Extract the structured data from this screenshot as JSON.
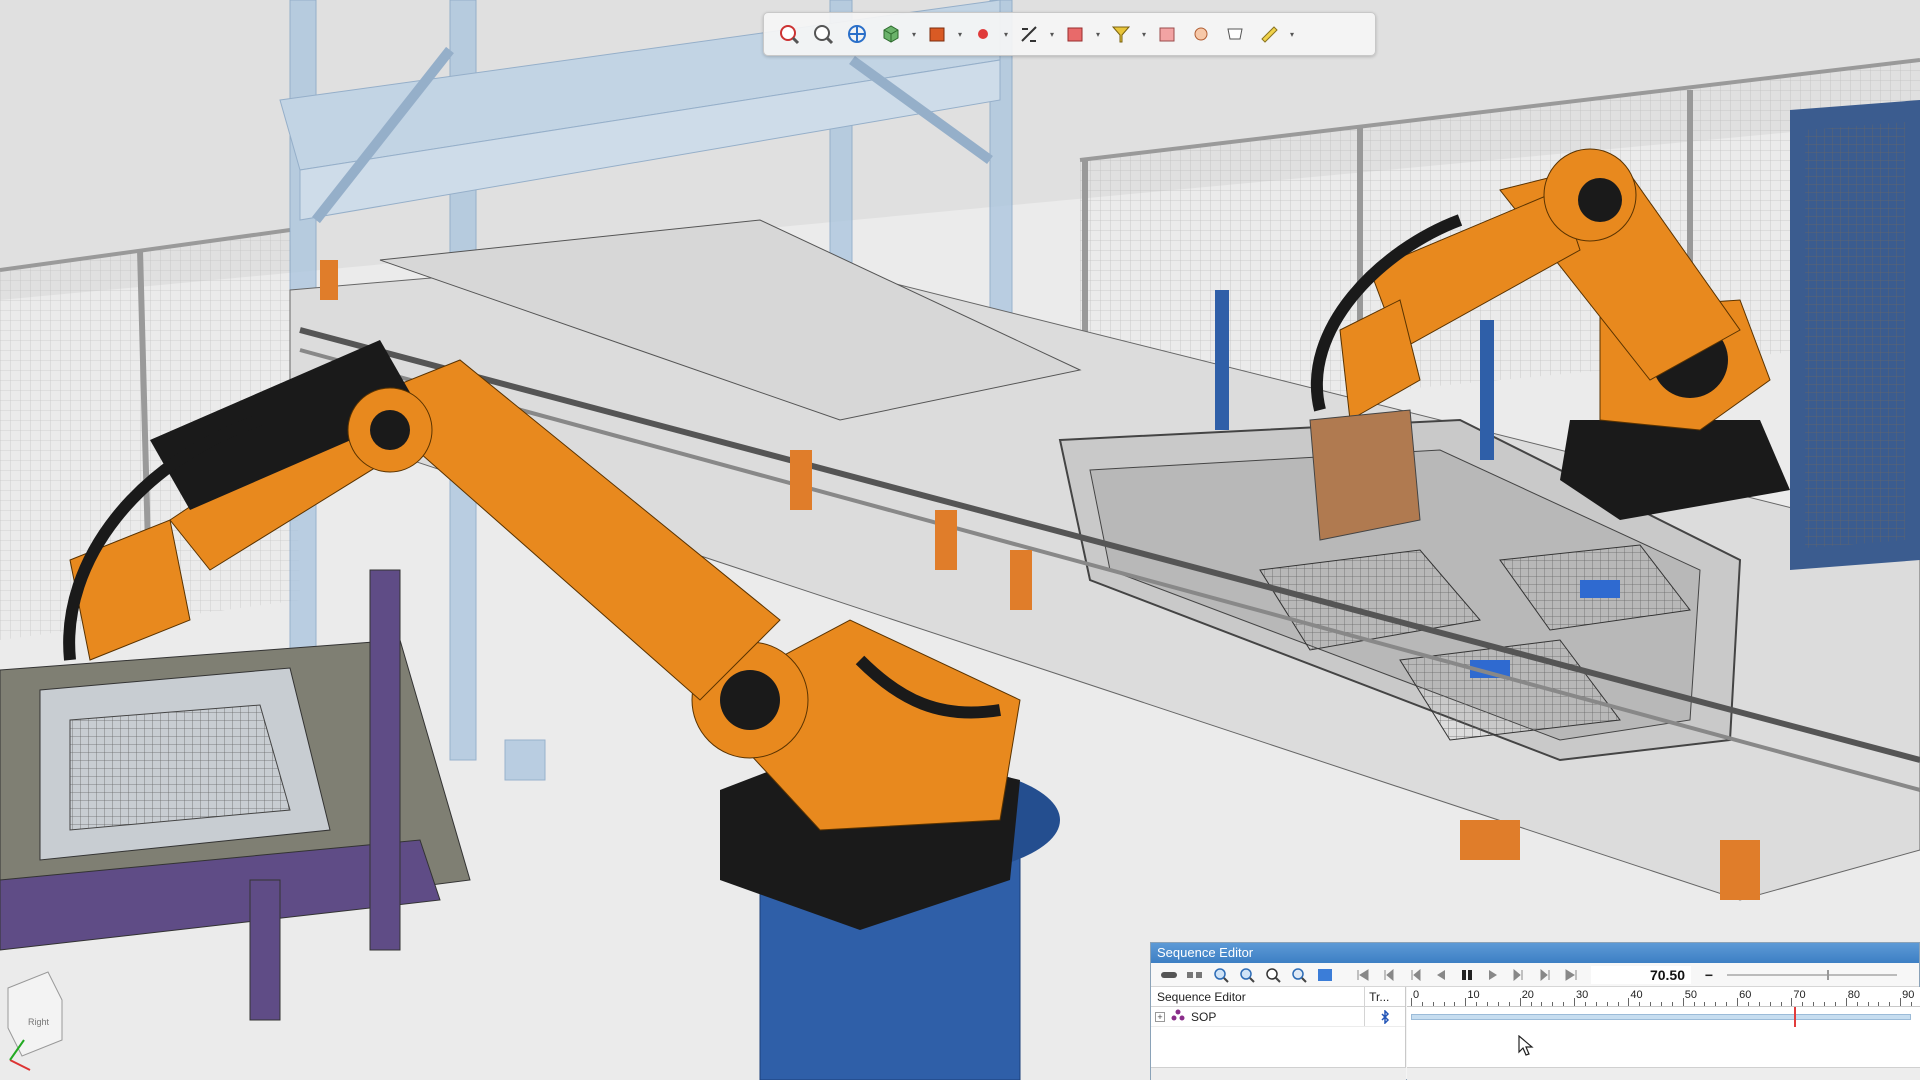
{
  "toolbar": {
    "buttons": [
      {
        "name": "zoom-to-fit-icon"
      },
      {
        "name": "zoom-icon"
      },
      {
        "name": "pan-icon"
      },
      {
        "name": "view-cube-icon"
      },
      {
        "name": "solid-view-icon"
      },
      {
        "name": "point-snap-icon"
      },
      {
        "name": "measure-icon"
      },
      {
        "name": "section-box-icon"
      },
      {
        "name": "pick-filter-icon"
      },
      {
        "name": "render-options-icon"
      },
      {
        "name": "placement-icon"
      },
      {
        "name": "display-filter-icon"
      },
      {
        "name": "ruler-icon"
      }
    ]
  },
  "sequence_editor": {
    "title": "Sequence Editor",
    "time_value": "70.50",
    "zoom_minus": "−",
    "columns": {
      "name": "Sequence Editor",
      "tr": "Tr..."
    },
    "rows": [
      {
        "expander": "+",
        "label": "SOP",
        "icon": "operation-tree-icon",
        "tr_icon": "bluetooth-link-icon"
      }
    ],
    "ruler_ticks": [
      "0",
      "10",
      "20",
      "30",
      "40",
      "50",
      "60",
      "70",
      "80",
      "90"
    ],
    "current_time": 70.5,
    "ruler_max": 92
  },
  "colors": {
    "robot_orange": "#e8891e",
    "robot_black": "#1a1a1a",
    "frame_blue": "#2f5fa8",
    "frame_glass": "#a9c4de",
    "floor": "#e9e9e9",
    "panel_title": "#3d7fc4"
  }
}
